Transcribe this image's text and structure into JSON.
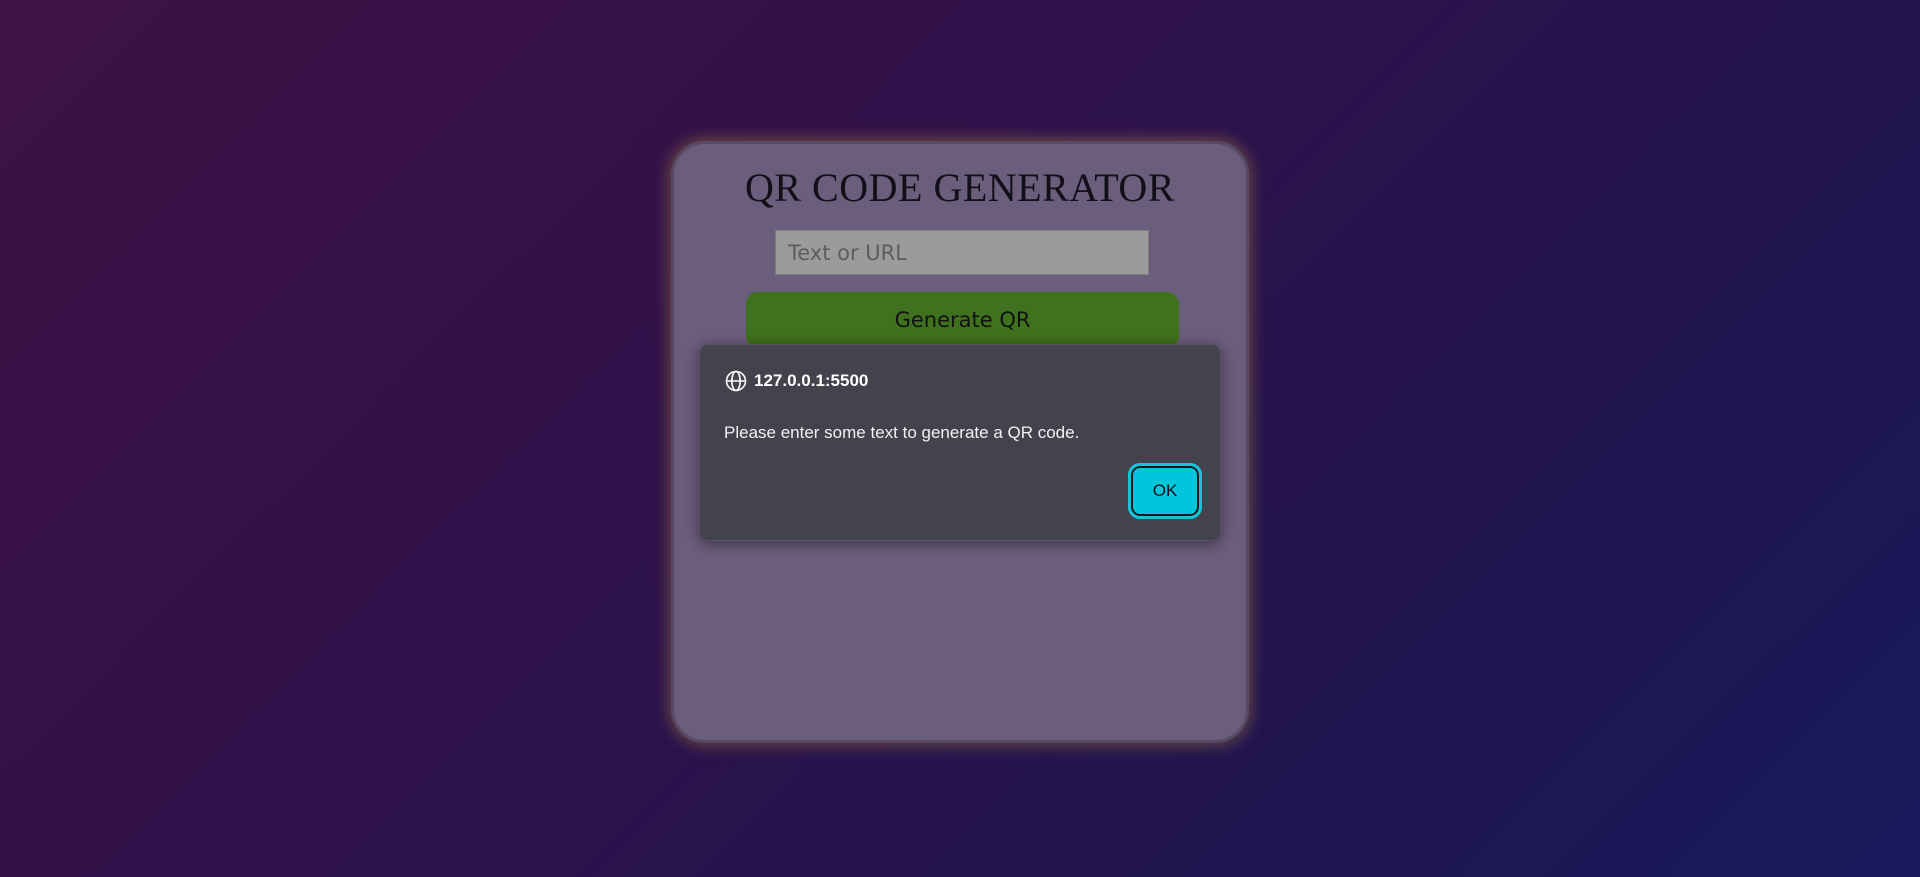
{
  "app": {
    "title": "QR CODE GENERATOR",
    "input": {
      "value": "",
      "placeholder": "Text or URL"
    },
    "generate_label": "Generate QR"
  },
  "dialog": {
    "icon": "globe-icon",
    "origin": "127.0.0.1:5500",
    "message": "Please enter some text to generate a QR code.",
    "ok_label": "OK"
  },
  "colors": {
    "card_background": "#6b5d7c",
    "generate_button": "#40711e",
    "dialog_background": "#43424d",
    "ok_button": "#00c6dc"
  }
}
